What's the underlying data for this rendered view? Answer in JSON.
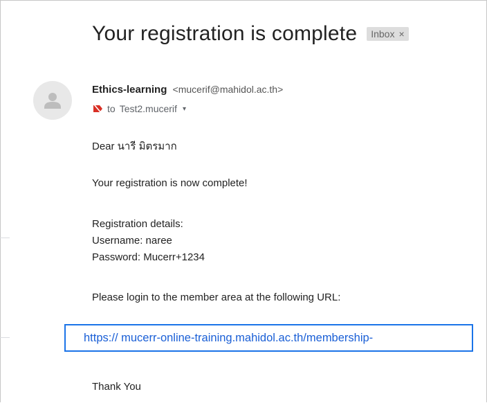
{
  "email": {
    "subject": "Your registration is complete",
    "label_badge": "Inbox",
    "label_close": "×",
    "sender_name": "Ethics-learning",
    "sender_email": "<mucerif@mahidol.ac.th>",
    "recipient_prefix": "to",
    "recipient": "Test2.mucerif",
    "recipient_chevron": "▾",
    "colors": {
      "link": "#1a5fd6",
      "highlight_border": "#1a73e8",
      "badge_bg": "#dddddd",
      "importance_marker": "#d93025"
    }
  },
  "body": {
    "greeting": "Dear นารี มิตรมาก",
    "line_complete": "Your registration is now complete!",
    "details_heading": "Registration details:",
    "username_line": "Username: naree",
    "password_line": "Password: Mucerr+1234",
    "login_instruction": "Please login to the member area at the following URL:",
    "url": "https:// mucerr-online-training.mahidol.ac.th/membership-",
    "closing": "Thank You"
  },
  "icons": {
    "avatar": "person-icon",
    "importance": "important-marker-icon",
    "chevron": "chevron-down-icon"
  }
}
